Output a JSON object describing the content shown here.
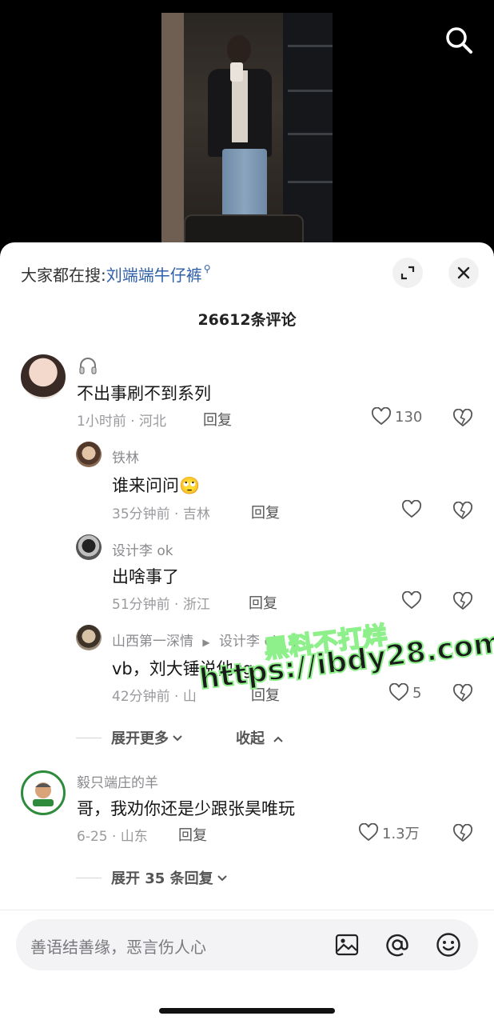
{
  "header": {
    "search_prefix": "大家都在搜:",
    "search_keyword": "刘端端牛仔裤"
  },
  "comment_count": "26612条评论",
  "comments": [
    {
      "name": "",
      "badge": "headphones-icon",
      "text": "不出事刷不到系列",
      "meta": "1小时前 · 河北",
      "reply_label": "回复",
      "likes": "130",
      "replies": [
        {
          "name": "铁林",
          "text": "谁来问问",
          "emoji": "🙄",
          "meta": "35分钟前 · 吉林",
          "reply_label": "回复",
          "likes": ""
        },
        {
          "name": "设计李 ok",
          "text": "出啥事了",
          "meta": "51分钟前 · 浙江",
          "reply_label": "回复",
          "likes": ""
        },
        {
          "name": "山西第一深情",
          "reply_to": "设计李 ok",
          "text": "vb，刘大锤说他cg",
          "meta": "42分钟前 · 山",
          "reply_label": "回复",
          "likes": "5"
        }
      ],
      "expand_more": "展开更多",
      "collapse": "收起"
    },
    {
      "name": "毅只端庄的羊",
      "text": "哥，我劝你还是少跟张昊唯玩",
      "meta": "6-25 · 山东",
      "reply_label": "回复",
      "likes": "1.3万",
      "expand_replies": "展开 35 条回复"
    }
  ],
  "input": {
    "placeholder": "善语结善缘，恶言伤人心"
  },
  "watermark": {
    "line1": "黑料不打烊",
    "line2": "https://ibdy28.com"
  },
  "colors": {
    "keyword": "#2f5fa8",
    "watermark_stroke": "#8ef08a"
  }
}
